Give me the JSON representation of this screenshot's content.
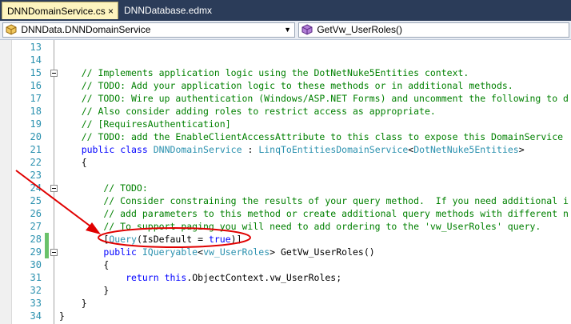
{
  "tabs": [
    {
      "label": "DNNDomainService.cs",
      "active": true,
      "close": "×"
    },
    {
      "label": "DNNDatabase.edmx",
      "active": false
    }
  ],
  "nav": {
    "class_combo": "DNNData.DNNDomainService",
    "member_combo": "GetVw_UserRoles()",
    "dropdown_glyph": "▼"
  },
  "colors": {
    "comment": "#008000",
    "keyword": "#0000ff",
    "type": "#2b91af",
    "annotation": "#e00000"
  },
  "lines": [
    {
      "n": "13",
      "tokens": []
    },
    {
      "n": "14",
      "tokens": []
    },
    {
      "n": "15",
      "fold": true,
      "tokens": [
        {
          "t": "    // Implements application logic using the DotNetNuke5Entities context.",
          "k": "comment"
        }
      ]
    },
    {
      "n": "16",
      "tokens": [
        {
          "t": "    // TODO: Add your application logic to these methods or in additional methods.",
          "k": "comment"
        }
      ]
    },
    {
      "n": "17",
      "tokens": [
        {
          "t": "    // TODO: Wire up authentication (Windows/ASP.NET Forms) and uncomment the following to d",
          "k": "comment"
        }
      ]
    },
    {
      "n": "18",
      "tokens": [
        {
          "t": "    // Also consider adding roles to restrict access as appropriate.",
          "k": "comment"
        }
      ]
    },
    {
      "n": "19",
      "tokens": [
        {
          "t": "    // [RequiresAuthentication]",
          "k": "comment"
        }
      ]
    },
    {
      "n": "20",
      "tokens": [
        {
          "t": "    // TODO: add the EnableClientAccessAttribute to this class to expose this DomainService",
          "k": "comment"
        }
      ]
    },
    {
      "n": "21",
      "tokens": [
        {
          "t": "    ",
          "k": "plain"
        },
        {
          "t": "public",
          "k": "keyword"
        },
        {
          "t": " ",
          "k": "plain"
        },
        {
          "t": "class",
          "k": "keyword"
        },
        {
          "t": " ",
          "k": "plain"
        },
        {
          "t": "DNNDomainService",
          "k": "type"
        },
        {
          "t": " : ",
          "k": "plain"
        },
        {
          "t": "LinqToEntitiesDomainService",
          "k": "type"
        },
        {
          "t": "<",
          "k": "plain"
        },
        {
          "t": "DotNetNuke5Entities",
          "k": "type"
        },
        {
          "t": ">",
          "k": "plain"
        }
      ]
    },
    {
      "n": "22",
      "tokens": [
        {
          "t": "    {",
          "k": "plain"
        }
      ]
    },
    {
      "n": "23",
      "tokens": []
    },
    {
      "n": "24",
      "fold": true,
      "tokens": [
        {
          "t": "        // TODO:",
          "k": "comment"
        }
      ]
    },
    {
      "n": "25",
      "tokens": [
        {
          "t": "        // Consider constraining the results of your query method.  If you need additional i",
          "k": "comment"
        }
      ]
    },
    {
      "n": "26",
      "tokens": [
        {
          "t": "        // add parameters to this method or create additional query methods with different n",
          "k": "comment"
        }
      ]
    },
    {
      "n": "27",
      "tokens": [
        {
          "t": "        // To support paging you will need to add ordering to the 'vw_UserRoles' query.",
          "k": "comment"
        }
      ]
    },
    {
      "n": "28",
      "changed": true,
      "tokens": [
        {
          "t": "        [",
          "k": "plain"
        },
        {
          "t": "Query",
          "k": "type"
        },
        {
          "t": "(IsDefault = ",
          "k": "plain"
        },
        {
          "t": "true",
          "k": "keyword"
        },
        {
          "t": ")]",
          "k": "plain"
        }
      ]
    },
    {
      "n": "29",
      "changed": true,
      "fold": true,
      "tokens": [
        {
          "t": "        ",
          "k": "plain"
        },
        {
          "t": "public",
          "k": "keyword"
        },
        {
          "t": " ",
          "k": "plain"
        },
        {
          "t": "IQueryable",
          "k": "type"
        },
        {
          "t": "<",
          "k": "plain"
        },
        {
          "t": "vw_UserRoles",
          "k": "type"
        },
        {
          "t": "> GetVw_UserRoles()",
          "k": "plain"
        }
      ]
    },
    {
      "n": "30",
      "tokens": [
        {
          "t": "        {",
          "k": "plain"
        }
      ]
    },
    {
      "n": "31",
      "tokens": [
        {
          "t": "            ",
          "k": "plain"
        },
        {
          "t": "return",
          "k": "keyword"
        },
        {
          "t": " ",
          "k": "plain"
        },
        {
          "t": "this",
          "k": "keyword"
        },
        {
          "t": ".ObjectContext.vw_UserRoles;",
          "k": "plain"
        }
      ]
    },
    {
      "n": "32",
      "tokens": [
        {
          "t": "        }",
          "k": "plain"
        }
      ]
    },
    {
      "n": "33",
      "tokens": [
        {
          "t": "    }",
          "k": "plain"
        }
      ]
    },
    {
      "n": "34",
      "tokens": [
        {
          "t": "}",
          "k": "plain"
        }
      ]
    }
  ]
}
